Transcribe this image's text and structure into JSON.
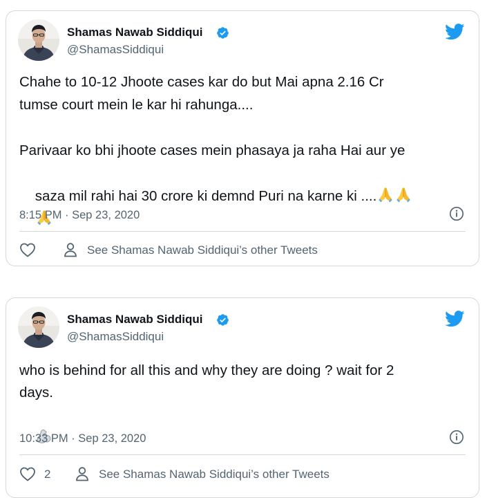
{
  "tweets": [
    {
      "author_name": "Shamas Nawab Siddiqui",
      "handle": "@ShamasSiddiqui",
      "text_line1": "Chahe to 10-12 Jhoote cases kar do but Mai apna 2.16 Cr",
      "text_line2": "tumse court mein le kar hi rahunga....",
      "text_line3": "Parivaar ko bhi jhoote cases mein phasaya ja raha Hai aur ye",
      "text_line4": "saza mil rahi hai 30 crore ki demnd Puri na karne ki ....",
      "emojis": "🙏🙏🙏",
      "timestamp": "8:15 PM · Sep 23, 2020",
      "like_count": "",
      "other_tweets_label": "See Shamas Nawab Siddiqui’s other Tweets"
    },
    {
      "author_name": "Shamas Nawab Siddiqui",
      "handle": "@ShamasSiddiqui",
      "text_line1": "who is behind for all this and why they are doing ? wait for 2",
      "text_line2": "days.",
      "emoji": "💪",
      "timestamp": "10:33 PM · Sep 23, 2020",
      "like_count": "2",
      "other_tweets_label": "See Shamas Nawab Siddiqui’s other Tweets"
    }
  ],
  "colors": {
    "twitter_blue": "#1d9bf0",
    "secondary_text": "#536471",
    "border": "#cfd9de"
  },
  "icons": [
    "verified-badge-icon",
    "twitter-bird-icon",
    "info-icon",
    "heart-icon",
    "person-icon",
    "pray-emoji",
    "flexed-biceps-emoji"
  ]
}
